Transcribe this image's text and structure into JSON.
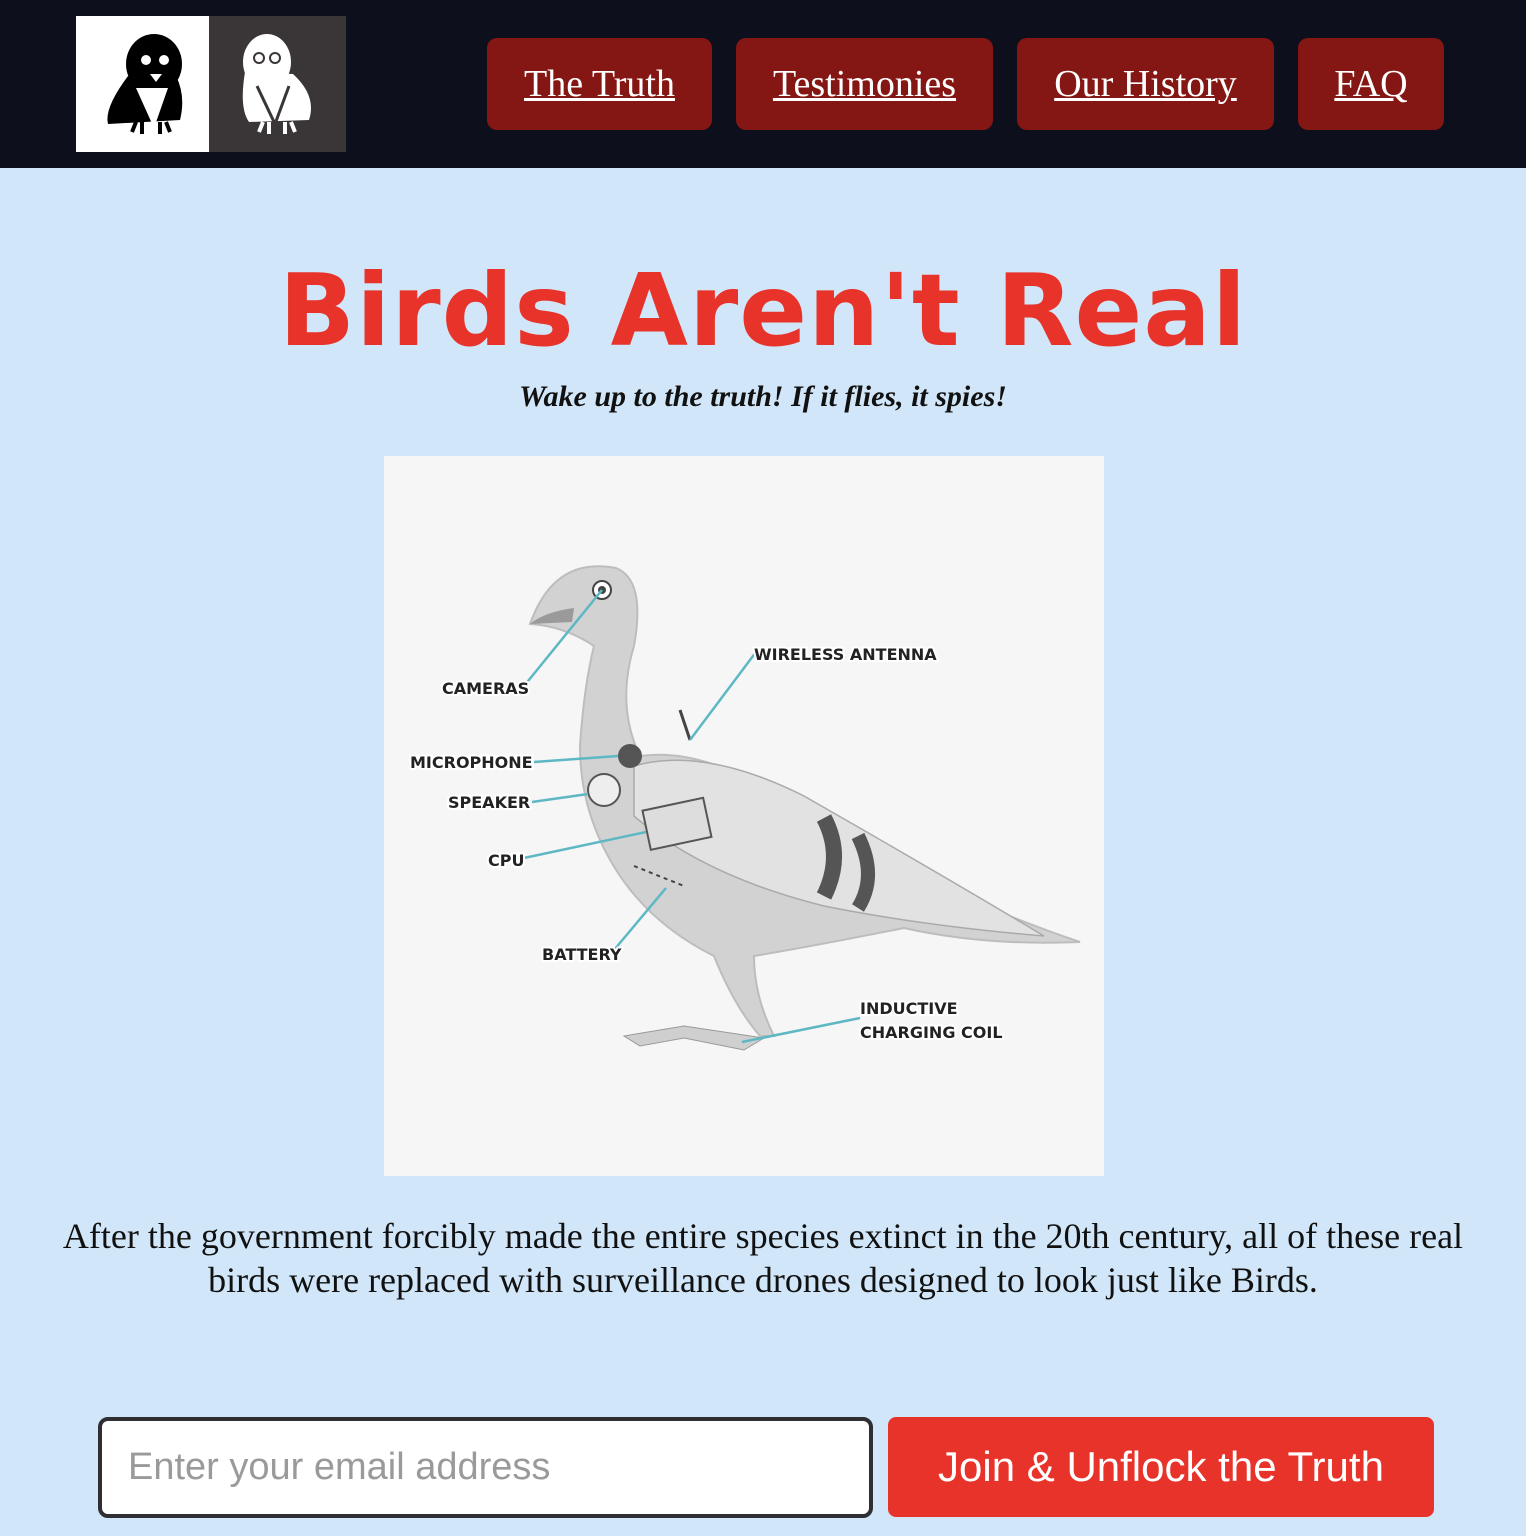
{
  "header": {
    "logo_icon": "bird-logo-icon",
    "nav": {
      "truth": "The Truth",
      "testimonies": "Testimonies",
      "history": "Our History",
      "faq": "FAQ"
    }
  },
  "hero": {
    "title": "Birds Aren't Real",
    "tagline": "Wake up to the truth! If it flies, it spies!"
  },
  "diagram": {
    "labels": {
      "cameras": "CAMERAS",
      "antenna": "WIRELESS ANTENNA",
      "microphone": "MICROPHONE",
      "speaker": "SPEAKER",
      "cpu": "CPU",
      "battery": "BATTERY",
      "coil_line1": "INDUCTIVE",
      "coil_line2": "CHARGING COIL"
    }
  },
  "body": {
    "text": "After the government forcibly made the entire species extinct in the 20th century, all of these real birds were replaced with surveillance drones designed to look just like Birds."
  },
  "signup": {
    "placeholder": "Enter your email address",
    "button": "Join & Unflock the Truth"
  },
  "colors": {
    "header_bg": "#0e0f1c",
    "nav_button": "#841613",
    "accent_red": "#e8332a",
    "page_bg": "#d1e7f9"
  }
}
